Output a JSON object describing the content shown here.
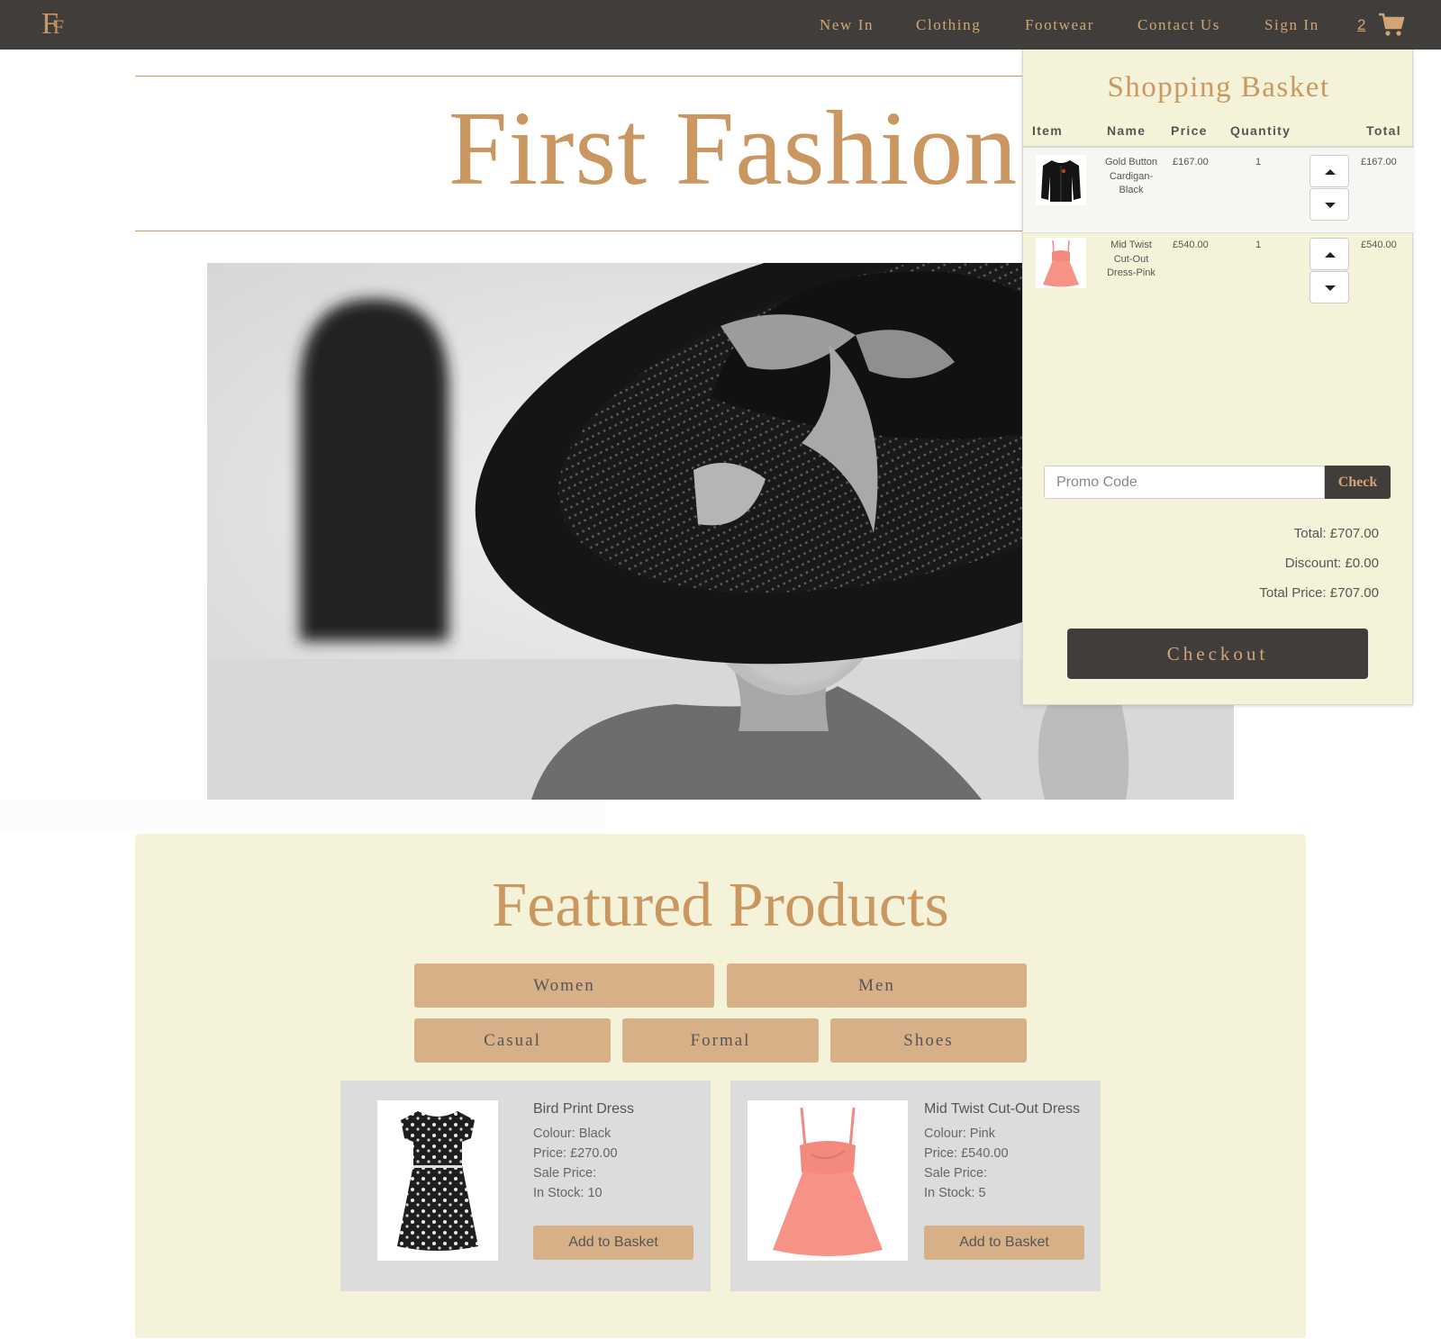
{
  "nav": {
    "logo": "FF",
    "links": [
      "New In",
      "Clothing",
      "Footwear",
      "Contact Us",
      "Sign In"
    ],
    "cart_count": "2"
  },
  "hero": {
    "title": "First Fashion"
  },
  "basket": {
    "title": "Shopping Basket",
    "headers": [
      "Item",
      "Name",
      "Price",
      "Quantity",
      "Total"
    ],
    "items": [
      {
        "name": "Gold Button Cardigan-Black",
        "price": "£167.00",
        "quantity": "1",
        "total": "£167.00"
      },
      {
        "name": "Mid Twist Cut-Out Dress-Pink",
        "price": "£540.00",
        "quantity": "1",
        "total": "£540.00"
      }
    ],
    "promo_placeholder": "Promo Code",
    "check_label": "Check",
    "total": "Total: £707.00",
    "discount": "Discount: £0.00",
    "total_price": "Total Price: £707.00",
    "checkout_label": "Checkout"
  },
  "featured": {
    "title": "Featured Products",
    "categories": [
      "Women",
      "Men",
      "Casual",
      "Formal",
      "Shoes"
    ],
    "products": [
      {
        "name": "Bird Print Dress",
        "colour": "Colour: Black",
        "price": "Price: £270.00",
        "sale": "Sale Price:",
        "stock": "In Stock: 10",
        "add_label": "Add to Basket"
      },
      {
        "name": "Mid Twist Cut-Out Dress",
        "colour": "Colour: Pink",
        "price": "Price: £540.00",
        "sale": "Sale Price:",
        "stock": "In Stock: 5",
        "add_label": "Add to Basket"
      }
    ]
  },
  "colors": {
    "nav_bg": "#403d3b",
    "gold": "#c9975f",
    "panel_bg": "#f4f3da",
    "button_tan": "#d7b088",
    "card_bg": "#dcdcdc"
  },
  "icons": [
    "cart-icon",
    "caret-up-icon",
    "caret-down-icon"
  ]
}
